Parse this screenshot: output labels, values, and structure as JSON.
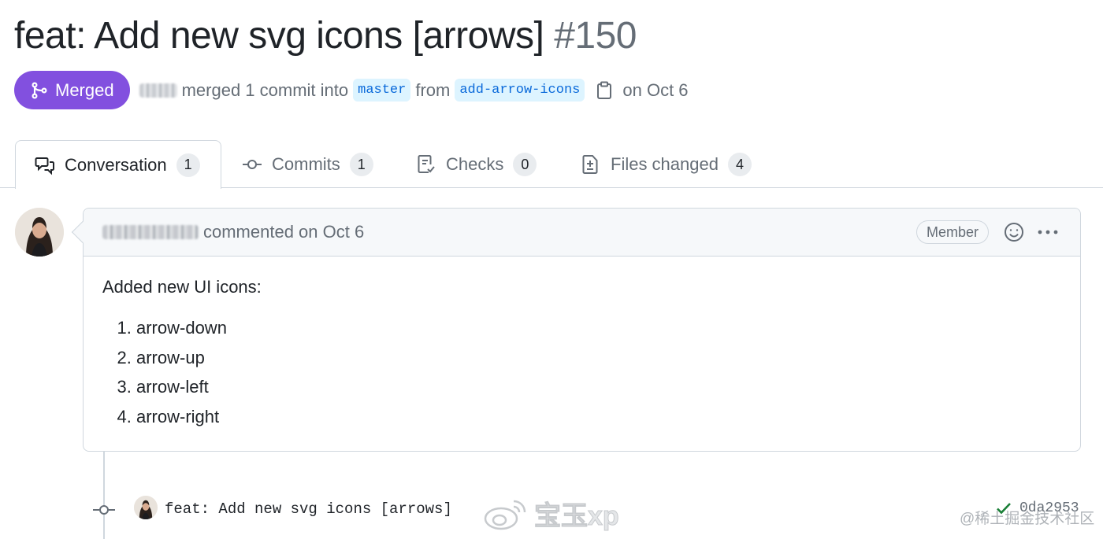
{
  "pr": {
    "title": "feat: Add new svg icons [arrows]",
    "number": "#150"
  },
  "meta": {
    "status": "Merged",
    "merged_text": "merged 1 commit into",
    "base_branch": "master",
    "from_text": "from",
    "head_branch": "add-arrow-icons",
    "date_text": "on Oct 6"
  },
  "tabs": [
    {
      "label": "Conversation",
      "count": "1",
      "icon": "comment-discussion-icon"
    },
    {
      "label": "Commits",
      "count": "1",
      "icon": "git-commit-icon"
    },
    {
      "label": "Checks",
      "count": "0",
      "icon": "checklist-icon"
    },
    {
      "label": "Files changed",
      "count": "4",
      "icon": "file-diff-icon"
    }
  ],
  "comment": {
    "action_text": "commented on Oct 6",
    "role_badge": "Member",
    "intro": "Added new UI icons:",
    "items": [
      "arrow-down",
      "arrow-up",
      "arrow-left",
      "arrow-right"
    ]
  },
  "commit": {
    "message": "feat: Add new svg icons [arrows]",
    "sha": "0da2953"
  },
  "watermarks": {
    "weibo": "宝玉xp",
    "juejin": "@稀土掘金技术社区"
  },
  "colors": {
    "merged": "#8250df",
    "branch_bg": "#ddf4ff",
    "branch_text": "#0969da",
    "success": "#1a7f37"
  }
}
